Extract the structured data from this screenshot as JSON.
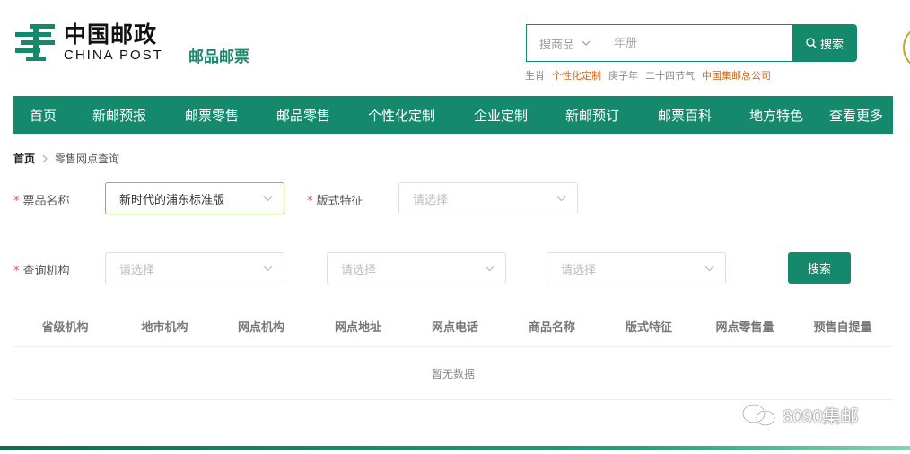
{
  "header": {
    "logo_cn": "中国邮政",
    "logo_en": "CHINA POST",
    "site_subtitle": "邮品邮票",
    "search": {
      "category": "搜商品",
      "placeholder": "年册",
      "button_label": "搜索"
    },
    "hot_words": [
      {
        "label": "生肖",
        "highlight": false
      },
      {
        "label": "个性化定制",
        "highlight": true
      },
      {
        "label": "庚子年",
        "highlight": false
      },
      {
        "label": "二十四节气",
        "highlight": false
      },
      {
        "label": "中国集邮总公司",
        "highlight": true
      }
    ]
  },
  "nav": {
    "items": [
      "首页",
      "新邮预报",
      "邮票零售",
      "邮品零售",
      "个性化定制",
      "企业定制",
      "新邮预订",
      "邮票百科",
      "地方特色",
      "查看更多"
    ]
  },
  "breadcrumb": {
    "home": "首页",
    "current": "零售网点查询"
  },
  "form": {
    "required_mark": "*",
    "product_label": "票品名称",
    "product_value": "新时代的浦东标准版",
    "format_label": "版式特征",
    "format_placeholder": "请选择",
    "org_label": "查询机构",
    "org_placeholders": [
      "请选择",
      "请选择",
      "请选择"
    ],
    "search_button": "搜索"
  },
  "table": {
    "columns": [
      "省级机构",
      "地市机构",
      "网点机构",
      "网点地址",
      "网点电话",
      "商品名称",
      "版式特征",
      "网点零售量",
      "预售自提量"
    ],
    "empty_text": "暂无数据"
  },
  "watermark": "8090集邮",
  "colors": {
    "brand_green": "#15896b",
    "highlight_orange": "#d2691e",
    "required_red": "#e35555",
    "active_border": "#7cbf4a"
  }
}
